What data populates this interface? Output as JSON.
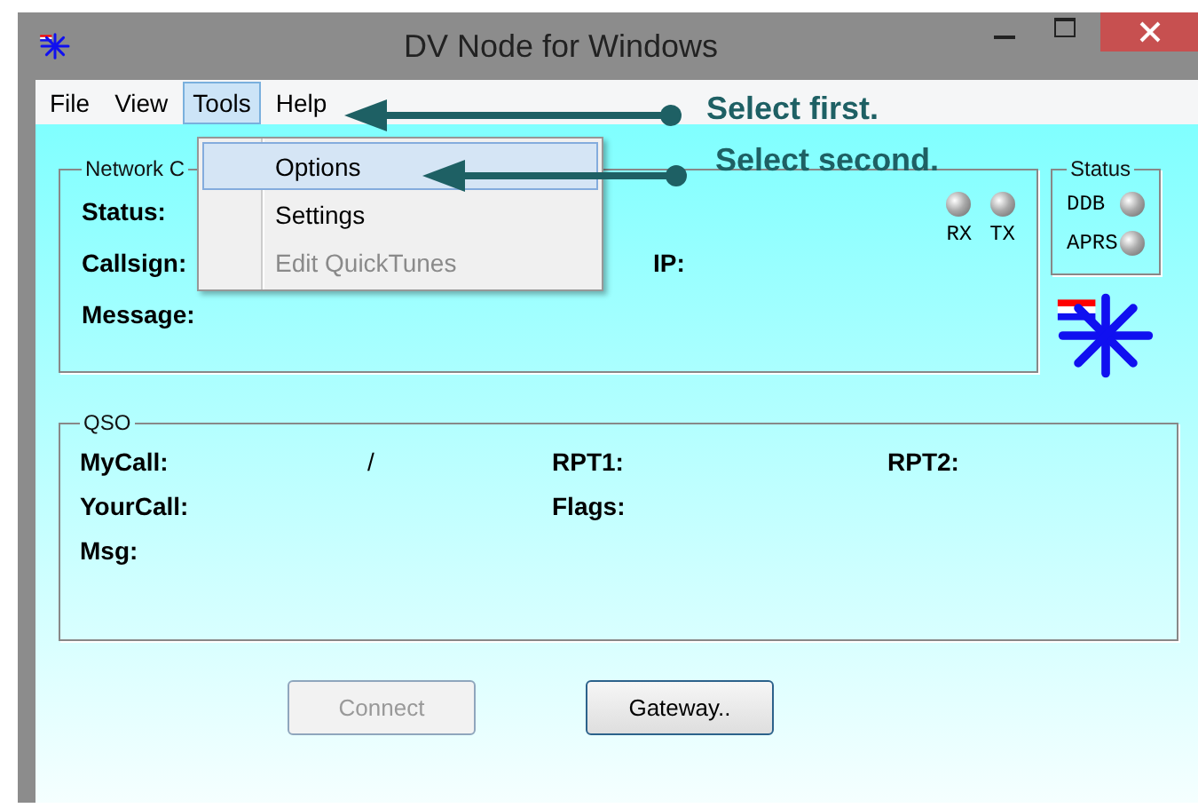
{
  "window": {
    "title": "DV Node for Windows"
  },
  "menu_bar": [
    {
      "label": "File",
      "selected": false
    },
    {
      "label": "View",
      "selected": false
    },
    {
      "label": "Tools",
      "selected": true
    },
    {
      "label": "Help",
      "selected": false
    }
  ],
  "dropdown": [
    {
      "label": "Options",
      "selected": true,
      "disabled": false
    },
    {
      "label": "Settings",
      "selected": false,
      "disabled": false
    },
    {
      "label": "Edit QuickTunes",
      "selected": false,
      "disabled": true
    }
  ],
  "annotations": [
    {
      "text": "Select first."
    },
    {
      "text": "Select second."
    }
  ],
  "network_group": {
    "title": "Network C",
    "leds": [
      {
        "label": "RX"
      },
      {
        "label": "TX"
      }
    ],
    "rows": [
      [
        "Status:"
      ],
      [
        "Callsign:",
        "IP:"
      ],
      [
        "Message:"
      ]
    ]
  },
  "status_group": {
    "title": "Status",
    "leds": [
      {
        "label": "DDB"
      },
      {
        "label": "APRS"
      }
    ]
  },
  "qso_group": {
    "title": "QSO",
    "rows": [
      [
        "MyCall:",
        "/",
        "RPT1:",
        "RPT2:"
      ],
      [
        "YourCall:",
        "",
        "Flags:",
        ""
      ],
      [
        "Msg:"
      ]
    ]
  },
  "buttons": [
    {
      "label": "Connect",
      "disabled": true
    },
    {
      "label": "Gateway..",
      "disabled": false
    }
  ]
}
